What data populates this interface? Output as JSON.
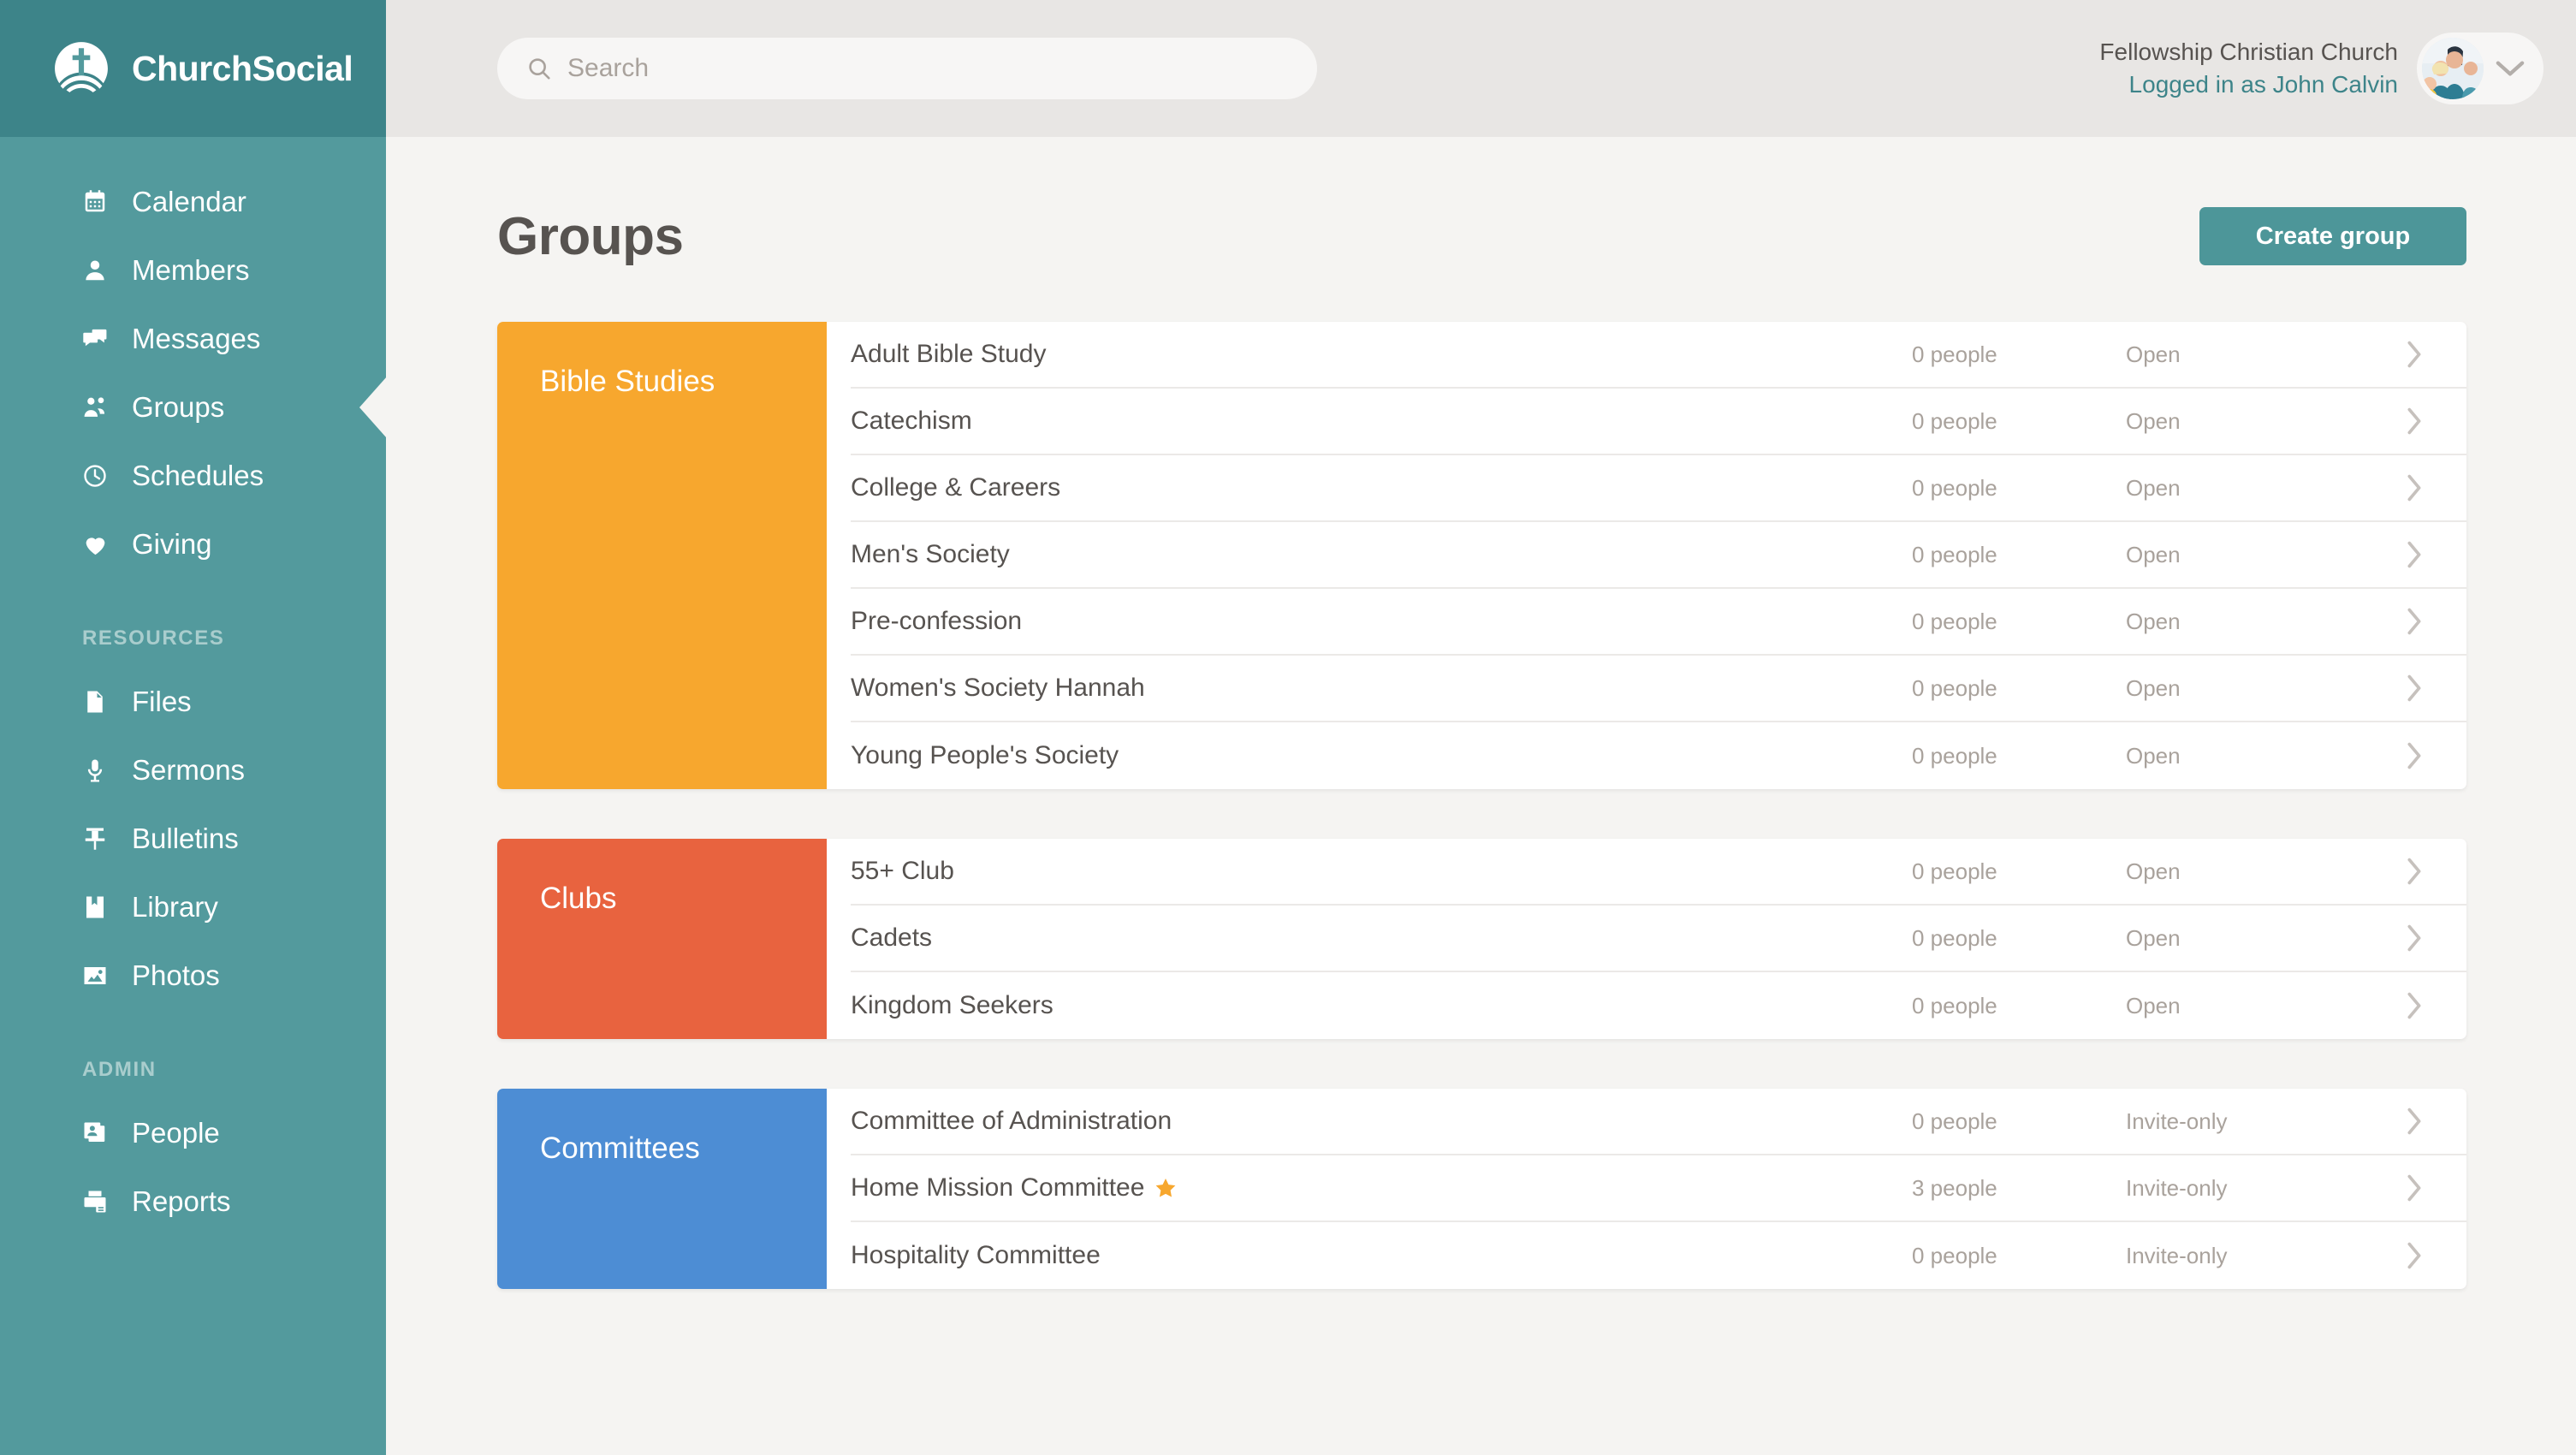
{
  "brand": {
    "name": "ChurchSocial",
    "logo_icon": "church-cross-icon",
    "header_color": "#3d8489",
    "sidebar_color": "#539a9d"
  },
  "search": {
    "placeholder": "Search",
    "icon": "search-icon",
    "value": ""
  },
  "account": {
    "church": "Fellowship Christian Church",
    "logged_in_as": "Logged in as John Calvin",
    "avatar_icon": "user-avatar-photo",
    "chevron_icon": "chevron-down-icon"
  },
  "sidebar": {
    "primary": [
      {
        "label": "Calendar",
        "icon": "calendar-icon",
        "active": false
      },
      {
        "label": "Members",
        "icon": "person-icon",
        "active": false
      },
      {
        "label": "Messages",
        "icon": "chat-bubbles-icon",
        "active": false
      },
      {
        "label": "Groups",
        "icon": "group-people-icon",
        "active": true
      },
      {
        "label": "Schedules",
        "icon": "clock-icon",
        "active": false
      },
      {
        "label": "Giving",
        "icon": "heart-icon",
        "active": false
      }
    ],
    "sections": [
      {
        "title": "RESOURCES",
        "items": [
          {
            "label": "Files",
            "icon": "document-icon",
            "active": false
          },
          {
            "label": "Sermons",
            "icon": "microphone-icon",
            "active": false
          },
          {
            "label": "Bulletins",
            "icon": "pushpin-icon",
            "active": false
          },
          {
            "label": "Library",
            "icon": "book-icon",
            "active": false
          },
          {
            "label": "Photos",
            "icon": "image-icon",
            "active": false
          }
        ]
      },
      {
        "title": "ADMIN",
        "items": [
          {
            "label": "People",
            "icon": "people-cards-icon",
            "active": false
          },
          {
            "label": "Reports",
            "icon": "printer-icon",
            "active": false
          }
        ]
      }
    ]
  },
  "page": {
    "title": "Groups",
    "create_button": "Create group",
    "create_button_color": "#4d9699"
  },
  "groups": [
    {
      "category": "Bible Studies",
      "color": "#f7a72e",
      "rows": [
        {
          "name": "Adult Bible Study",
          "people": "0 people",
          "status": "Open",
          "starred": false
        },
        {
          "name": "Catechism",
          "people": "0 people",
          "status": "Open",
          "starred": false
        },
        {
          "name": "College & Careers",
          "people": "0 people",
          "status": "Open",
          "starred": false
        },
        {
          "name": "Men's Society",
          "people": "0 people",
          "status": "Open",
          "starred": false
        },
        {
          "name": "Pre-confession",
          "people": "0 people",
          "status": "Open",
          "starred": false
        },
        {
          "name": "Women's Society Hannah",
          "people": "0 people",
          "status": "Open",
          "starred": false
        },
        {
          "name": "Young People's Society",
          "people": "0 people",
          "status": "Open",
          "starred": false
        }
      ]
    },
    {
      "category": "Clubs",
      "color": "#e8633f",
      "rows": [
        {
          "name": "55+ Club",
          "people": "0 people",
          "status": "Open",
          "starred": false
        },
        {
          "name": "Cadets",
          "people": "0 people",
          "status": "Open",
          "starred": false
        },
        {
          "name": "Kingdom Seekers",
          "people": "0 people",
          "status": "Open",
          "starred": false
        }
      ]
    },
    {
      "category": "Committees",
      "color": "#4d8dd4",
      "rows": [
        {
          "name": "Committee of Administration",
          "people": "0 people",
          "status": "Invite-only",
          "starred": false
        },
        {
          "name": "Home Mission Committee",
          "people": "3 people",
          "status": "Invite-only",
          "starred": true
        },
        {
          "name": "Hospitality Committee",
          "people": "0 people",
          "status": "Invite-only",
          "starred": false
        }
      ]
    }
  ]
}
